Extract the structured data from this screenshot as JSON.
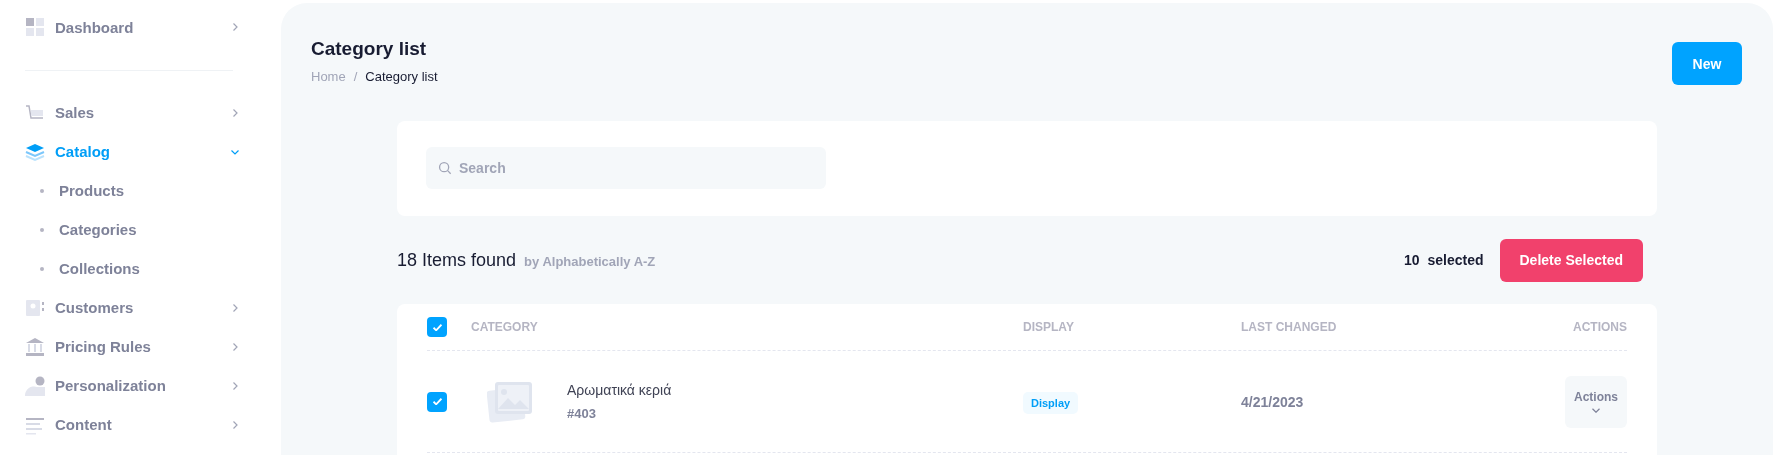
{
  "sidebar": {
    "items": [
      {
        "label": "Dashboard",
        "selected": false,
        "expanded": false
      },
      {
        "label": "Sales",
        "selected": false,
        "expanded": false
      },
      {
        "label": "Catalog",
        "selected": true,
        "expanded": true,
        "children": [
          {
            "label": "Products"
          },
          {
            "label": "Categories"
          },
          {
            "label": "Collections"
          }
        ]
      },
      {
        "label": "Customers",
        "selected": false,
        "expanded": false
      },
      {
        "label": "Pricing Rules",
        "selected": false,
        "expanded": false
      },
      {
        "label": "Personalization",
        "selected": false,
        "expanded": false
      },
      {
        "label": "Content",
        "selected": false,
        "expanded": false
      }
    ]
  },
  "page": {
    "title": "Category list",
    "breadcrumb": [
      "Home",
      "Category list"
    ],
    "breadcrumb_separator": "/",
    "new_button": "New"
  },
  "search": {
    "placeholder": "Search"
  },
  "summary": {
    "count": "18 Items found",
    "sort": "by Alphabetically A-Z",
    "selected_count": "10",
    "selected_label": "selected",
    "delete_button": "Delete Selected"
  },
  "table": {
    "all_checked": true,
    "columns": [
      "CATEGORY",
      "DISPLAY",
      "LAST CHANGED",
      "ACTIONS"
    ],
    "rows": [
      {
        "checked": true,
        "name": "Αρωματικά κεριά",
        "id": "#403",
        "display": "Display",
        "last_changed": "4/21/2023",
        "actions": "Actions"
      }
    ]
  }
}
